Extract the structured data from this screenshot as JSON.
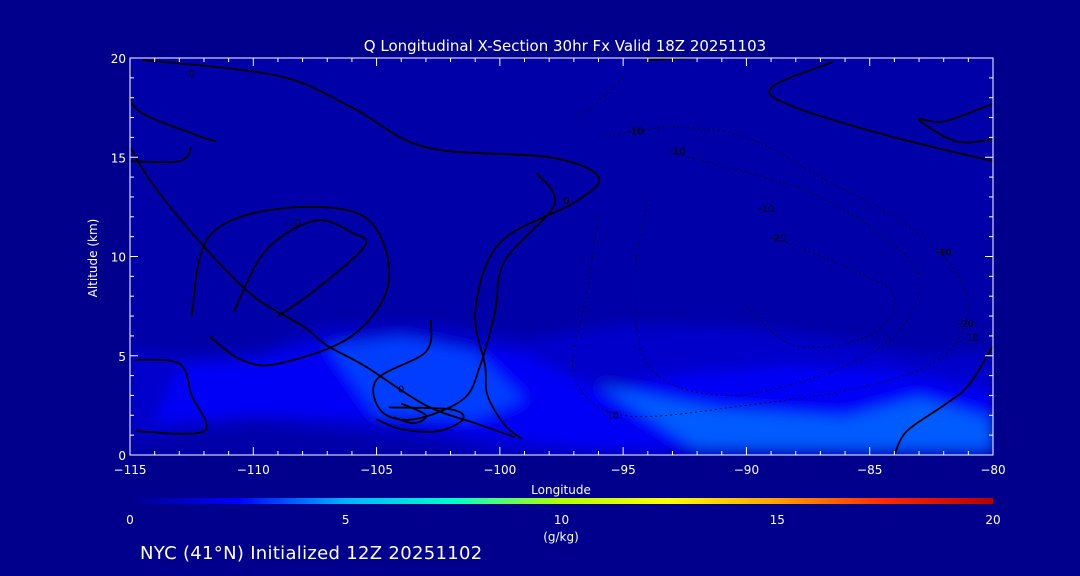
{
  "chart_data": {
    "type": "heatmap",
    "title": "Q Longitudinal X-Section 30hr  Fx Valid 18Z 20251103",
    "xlabel": "Longitude",
    "ylabel": "Altitude (km)",
    "xlim": [
      -115,
      -80
    ],
    "ylim": [
      0,
      20
    ],
    "x_ticks": [
      -115,
      -110,
      -105,
      -100,
      -95,
      -90,
      -85,
      -80
    ],
    "x_tick_labels": [
      "−115",
      "−110",
      "−105",
      "−100",
      "−95",
      "−90",
      "−85",
      "−80"
    ],
    "y_ticks": [
      0,
      5,
      10,
      15,
      20
    ],
    "y_tick_labels": [
      "0",
      "5",
      "10",
      "15",
      "20"
    ],
    "colorbar": {
      "label": "(g/kg)",
      "min": 0,
      "max": 20,
      "ticks": [
        0,
        5,
        10,
        15,
        20
      ],
      "tick_labels": [
        "0",
        "5",
        "10",
        "15",
        "20"
      ],
      "stops": [
        "#00008c",
        "#0000ff",
        "#00b4ff",
        "#00ffc8",
        "#b4ff00",
        "#ffff00",
        "#ffa000",
        "#ff2800",
        "#b40000"
      ]
    },
    "moisture_fields": [
      {
        "q": 1.5,
        "points": [
          [
            -115,
            0.8
          ],
          [
            -115,
            5.3
          ],
          [
            -113,
            5
          ],
          [
            -110,
            5.2
          ],
          [
            -107,
            6.5
          ],
          [
            -103,
            6.6
          ],
          [
            -99,
            5.8
          ],
          [
            -95,
            6.6
          ],
          [
            -90,
            6.4
          ],
          [
            -86,
            5.8
          ],
          [
            -83,
            5.0
          ],
          [
            -80,
            5.2
          ],
          [
            -80,
            0
          ],
          [
            -100,
            0
          ],
          [
            -103,
            0.8
          ],
          [
            -110,
            1.6
          ]
        ]
      },
      {
        "q": 2.5,
        "points": [
          [
            -114,
            1.6
          ],
          [
            -113,
            4.5
          ],
          [
            -110,
            4.7
          ],
          [
            -107,
            5.6
          ],
          [
            -103,
            5.6
          ],
          [
            -99,
            5.1
          ],
          [
            -96,
            3.2
          ],
          [
            -93,
            4.0
          ],
          [
            -88,
            4.5
          ],
          [
            -84,
            4.2
          ],
          [
            -80,
            3.2
          ],
          [
            -80,
            0.3
          ],
          [
            -96,
            0.3
          ],
          [
            -100,
            0.9
          ],
          [
            -104,
            1.7
          ],
          [
            -110,
            2.1
          ]
        ]
      },
      {
        "q": 3.5,
        "points": [
          [
            -107,
            5.5
          ],
          [
            -104,
            6.0
          ],
          [
            -101,
            5.2
          ],
          [
            -99,
            2.8
          ],
          [
            -101,
            1.8
          ],
          [
            -105,
            2.0
          ]
        ]
      },
      {
        "q": 4.0,
        "points": [
          [
            -96,
            3.5
          ],
          [
            -91,
            2.3
          ],
          [
            -86,
            1.9
          ],
          [
            -83,
            2.9
          ],
          [
            -80,
            1.8
          ],
          [
            -80,
            0.2
          ],
          [
            -92,
            0.3
          ]
        ]
      }
    ],
    "contours": [
      {
        "label": "0",
        "style": "solid",
        "points": [
          [
            -114.5,
            19.9
          ],
          [
            -109,
            19.1
          ],
          [
            -106,
            17.5
          ],
          [
            -103,
            15.5
          ],
          [
            -98,
            15
          ],
          [
            -96,
            14
          ],
          [
            -97,
            12.7
          ],
          [
            -100,
            10.7
          ],
          [
            -101,
            7.3
          ],
          [
            -100.6,
            4.5
          ],
          [
            -100.5,
            3.0
          ],
          [
            -99.8,
            1.5
          ],
          [
            -99.1,
            0.8
          ]
        ]
      },
      {
        "label": "0",
        "style": "solid",
        "points": [
          [
            -99.4,
            0.9
          ],
          [
            -101,
            1.6
          ],
          [
            -103,
            2.5
          ],
          [
            -105.5,
            4.5
          ],
          [
            -107,
            5.5
          ],
          [
            -108,
            6.5
          ],
          [
            -110,
            8.0
          ],
          [
            -112,
            10.5
          ],
          [
            -114,
            13.5
          ],
          [
            -115,
            15.5
          ]
        ]
      },
      {
        "label": "",
        "style": "solid",
        "points": [
          [
            -115,
            19.5
          ],
          [
            -114.8,
            17.5
          ],
          [
            -112.5,
            16.2
          ],
          [
            -111.5,
            15.8
          ]
        ]
      },
      {
        "label": "",
        "style": "solid",
        "points": [
          [
            -115,
            14.8
          ],
          [
            -113,
            14.8
          ],
          [
            -112.5,
            15.5
          ]
        ]
      },
      {
        "label": "",
        "style": "solid",
        "points": [
          [
            -114.8,
            4.8
          ],
          [
            -113,
            4.6
          ],
          [
            -112.5,
            3.0
          ],
          [
            -112,
            1.2
          ],
          [
            -114.8,
            1.2
          ]
        ]
      },
      {
        "label": "10",
        "style": "solid",
        "points": [
          [
            -112.5,
            7
          ],
          [
            -111.8,
            11
          ],
          [
            -109,
            12.4
          ],
          [
            -105.5,
            12
          ],
          [
            -104.5,
            8.8
          ],
          [
            -106,
            6
          ],
          [
            -109,
            4.6
          ],
          [
            -110.5,
            4.8
          ],
          [
            -111.8,
            6
          ]
        ]
      },
      {
        "label": "",
        "style": "solid",
        "points": [
          [
            -110.8,
            7.2
          ],
          [
            -109.5,
            10.3
          ],
          [
            -107.5,
            11.8
          ],
          [
            -106,
            11.2
          ],
          [
            -105.5,
            10.5
          ],
          [
            -107.5,
            8.3
          ],
          [
            -109,
            7.0
          ]
        ]
      },
      {
        "label": "0",
        "style": "solid",
        "points": [
          [
            -98.5,
            14.2
          ],
          [
            -97.8,
            12.6
          ],
          [
            -99.8,
            9.8
          ],
          [
            -100.2,
            7.2
          ],
          [
            -100.8,
            4.5
          ],
          [
            -101.5,
            2.8
          ],
          [
            -103.5,
            1.8
          ],
          [
            -104.8,
            2.2
          ],
          [
            -105,
            3.8
          ],
          [
            -103,
            5.2
          ],
          [
            -102.8,
            6.8
          ]
        ]
      },
      {
        "label": "0",
        "style": "solid",
        "points": [
          [
            -104.5,
            2.4
          ],
          [
            -102,
            2.3
          ],
          [
            -101.5,
            1.8
          ],
          [
            -102.5,
            1.2
          ],
          [
            -104,
            1.3
          ],
          [
            -105,
            1.8
          ]
        ]
      },
      {
        "label": "",
        "style": "solid",
        "points": [
          [
            -104,
            2.6
          ],
          [
            -103,
            2.0
          ],
          [
            -103.5,
            1.6
          ],
          [
            -104.3,
            1.9
          ]
        ]
      },
      {
        "label": "",
        "style": "solid",
        "points": [
          [
            -94,
            19.9
          ],
          [
            -92,
            20
          ]
        ]
      },
      {
        "label": "",
        "style": "solid",
        "points": [
          [
            -86.5,
            19.8
          ],
          [
            -89,
            18.5
          ],
          [
            -88,
            17.5
          ],
          [
            -84,
            16
          ],
          [
            -80,
            14.8
          ]
        ]
      },
      {
        "label": "",
        "style": "solid",
        "points": [
          [
            -80,
            17.7
          ],
          [
            -82,
            16.8
          ],
          [
            -83,
            16.9
          ],
          [
            -81.5,
            15.8
          ],
          [
            -80,
            15.9
          ]
        ]
      },
      {
        "label": "",
        "style": "solid",
        "points": [
          [
            -80,
            5.5
          ],
          [
            -81,
            3.5
          ],
          [
            -82,
            2.5
          ],
          [
            -83.5,
            1.2
          ],
          [
            -84,
            0
          ]
        ]
      },
      {
        "label": "-10",
        "style": "dashed",
        "points": [
          [
            -96,
            16
          ],
          [
            -93,
            16.5
          ],
          [
            -90,
            16
          ],
          [
            -87,
            14
          ],
          [
            -84,
            12
          ],
          [
            -82,
            10
          ],
          [
            -81,
            7.5
          ],
          [
            -82,
            5
          ],
          [
            -85,
            3.5
          ],
          [
            -90,
            2.5
          ],
          [
            -95,
            2
          ],
          [
            -97,
            4
          ],
          [
            -96.5,
            8
          ],
          [
            -96,
            12
          ]
        ]
      },
      {
        "label": "-10",
        "style": "dashed",
        "points": [
          [
            -93,
            15.2
          ],
          [
            -88,
            13.5
          ],
          [
            -85,
            11.5
          ],
          [
            -83,
            9
          ],
          [
            -84,
            6
          ],
          [
            -87,
            4
          ],
          [
            -91,
            3
          ],
          [
            -94,
            4.5
          ],
          [
            -94.5,
            9
          ],
          [
            -94,
            13
          ]
        ]
      },
      {
        "label": "-20",
        "style": "dashed",
        "points": [
          [
            -89,
            11
          ],
          [
            -86,
            9.5
          ],
          [
            -84,
            8
          ],
          [
            -85,
            6
          ],
          [
            -88,
            5.5
          ],
          [
            -90,
            7.5
          ]
        ]
      },
      {
        "label": "-10",
        "style": "dashed",
        "points": [
          [
            -95,
            19
          ],
          [
            -96,
            17.8
          ],
          [
            -97,
            16.9
          ]
        ]
      }
    ],
    "contour_labels": [
      {
        "text": "0",
        "x": -112.5,
        "y": 19.2
      },
      {
        "text": "-10",
        "x": -108.4,
        "y": 11.7
      },
      {
        "text": "0",
        "x": -97.3,
        "y": 12.8
      },
      {
        "text": "0",
        "x": -104,
        "y": 3.3
      },
      {
        "text": "0",
        "x": -94,
        "y": 19.9
      },
      {
        "text": "-10",
        "x": -94.5,
        "y": 16.3
      },
      {
        "text": "-10",
        "x": -92.8,
        "y": 15.3
      },
      {
        "text": "-10",
        "x": -89.2,
        "y": 12.4
      },
      {
        "text": "-20",
        "x": -88.7,
        "y": 10.9
      },
      {
        "text": "-10",
        "x": -82,
        "y": 10.2
      },
      {
        "text": "-20",
        "x": -81.1,
        "y": 6.6
      },
      {
        "text": "-10",
        "x": -80.9,
        "y": 5.9
      },
      {
        "text": "-10",
        "x": -95.5,
        "y": 2.0
      }
    ]
  },
  "footer": {
    "location_text": "NYC (41°N) Initialized 12Z 20251102"
  },
  "colors": {
    "background": "#00008c",
    "frame": "#ffffff",
    "contour": "#000000"
  }
}
